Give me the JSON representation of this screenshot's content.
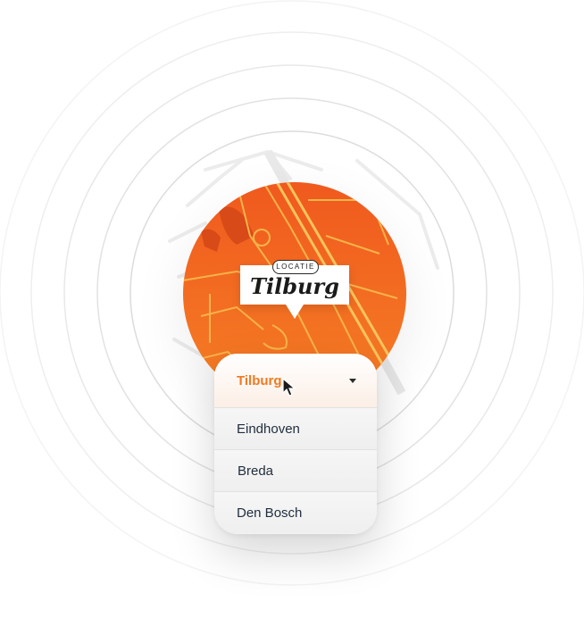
{
  "badge": {
    "tag": "LOCATIE",
    "city": "Tilburg"
  },
  "dropdown": {
    "selected": "Tilburg",
    "options": [
      "Eindhoven",
      "Breda",
      "Den Bosch"
    ]
  },
  "colors": {
    "accent": "#f07a22",
    "map_orange": "#f2641f",
    "text_dark": "#1f2d3d"
  }
}
